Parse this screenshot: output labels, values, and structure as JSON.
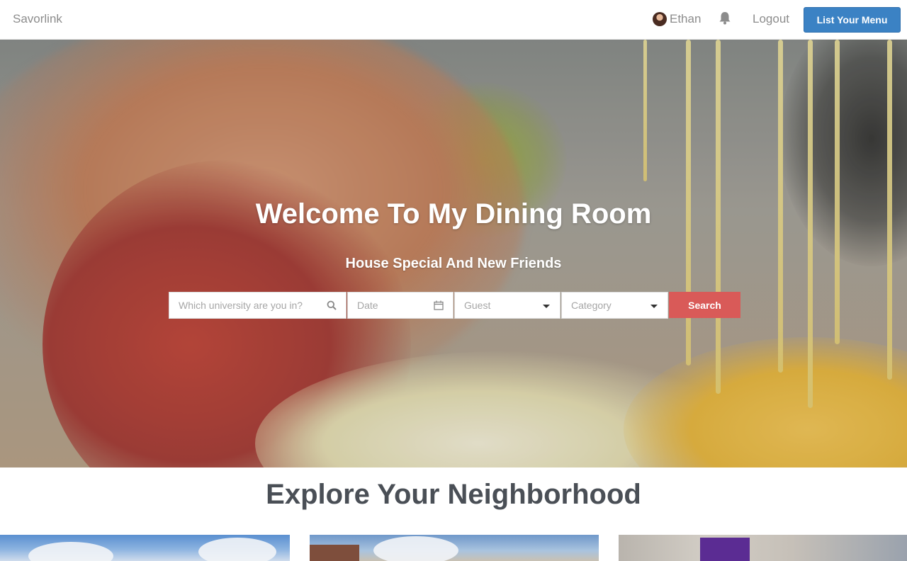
{
  "navbar": {
    "brand": "Savorlink",
    "user_name": "Ethan",
    "logout_label": "Logout",
    "list_menu_label": "List Your Menu"
  },
  "hero": {
    "title": "Welcome To My Dining Room",
    "subtitle": "House Special And New Friends"
  },
  "search": {
    "university_placeholder": "Which university are you in?",
    "date_placeholder": "Date",
    "guest_placeholder": "Guest",
    "category_placeholder": "Category",
    "button_label": "Search"
  },
  "explore": {
    "title": "Explore Your Neighborhood"
  },
  "colors": {
    "primary_button": "#3b82c4",
    "search_button": "#d95a58",
    "heading": "#4a4f56"
  }
}
